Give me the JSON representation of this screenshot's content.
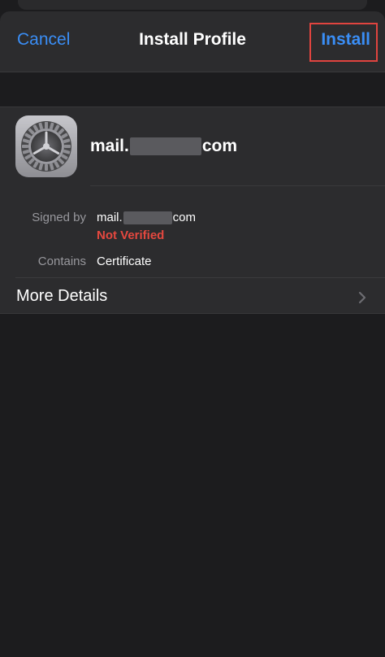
{
  "navbar": {
    "cancel_label": "Cancel",
    "title": "Install Profile",
    "install_label": "Install"
  },
  "profile": {
    "name_prefix": "mail.",
    "name_suffix": "com",
    "icon": "settings-gear-icon"
  },
  "details": {
    "signed_by_label": "Signed by",
    "signed_by_prefix": "mail.",
    "signed_by_suffix": "com",
    "verification_status": "Not Verified",
    "contains_label": "Contains",
    "contains_value": "Certificate"
  },
  "more_details": {
    "label": "More Details",
    "icon": "chevron-right-icon"
  },
  "colors": {
    "accent": "#3a8ef6",
    "warning": "#e5483f",
    "highlight_box": "#e0443f",
    "background": "#1c1c1e",
    "cell": "#2c2c2e"
  }
}
